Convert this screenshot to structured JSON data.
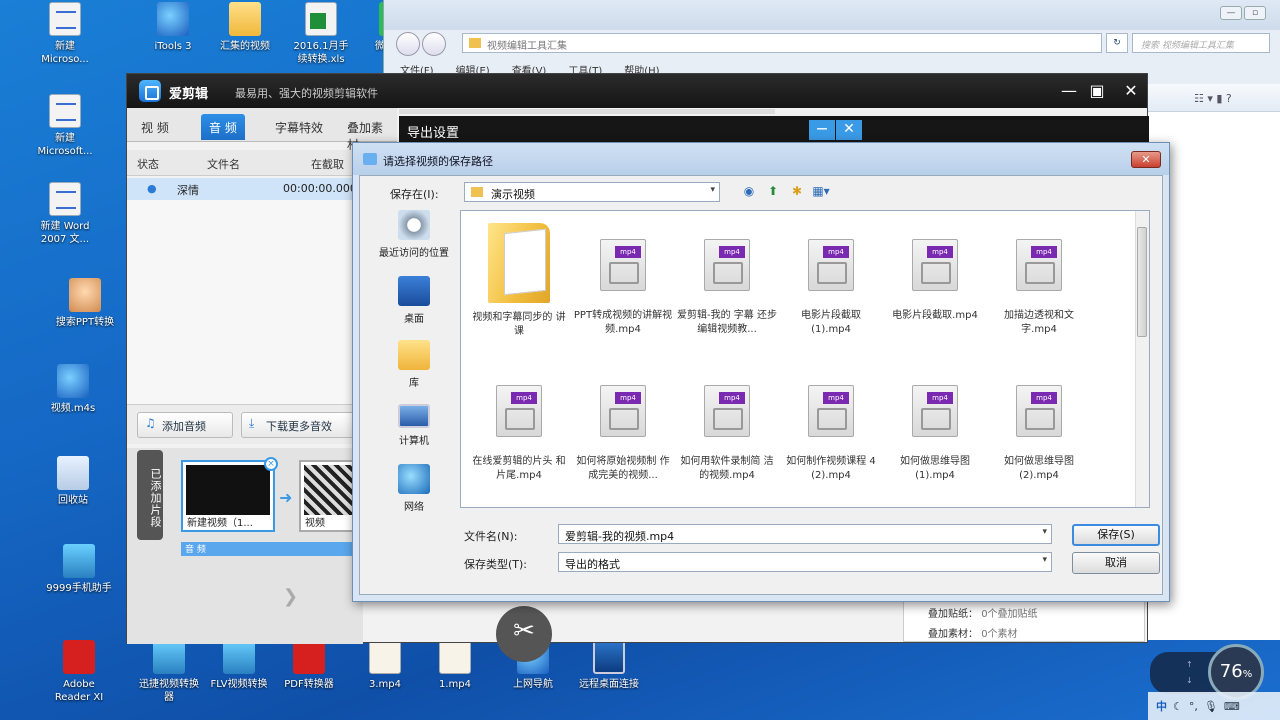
{
  "desktop": {
    "icons": [
      {
        "label": "新建 Microso...",
        "kind": "g-doc"
      },
      {
        "label": "iTools 3",
        "kind": "g-ie"
      },
      {
        "label": "汇集的视频",
        "kind": "g-folder"
      },
      {
        "label": "2016.1月手 续转换.xls",
        "kind": "g-xls"
      },
      {
        "label": "微信通讯",
        "kind": "g-green"
      },
      {
        "label": "新建 Microsoft...",
        "kind": "g-doc"
      },
      {
        "label": "新建 Word 2007 文...",
        "kind": "g-doc"
      },
      {
        "label": "搜索PPT转换",
        "kind": "g-face"
      },
      {
        "label": "视频.m4s",
        "kind": "g-ie"
      },
      {
        "label": "回收站",
        "kind": "g-bin"
      },
      {
        "label": "9999手机助手",
        "kind": "g-app"
      },
      {
        "label": "Adobe Reader XI",
        "kind": "g-red"
      },
      {
        "label": "迅捷视频转换器",
        "kind": "g-app"
      },
      {
        "label": "FLV视频转换",
        "kind": "g-app"
      },
      {
        "label": "PDF转换器",
        "kind": "g-red"
      },
      {
        "label": "3.mp4",
        "kind": "g-paper"
      },
      {
        "label": "1.mp4",
        "kind": "g-paper"
      },
      {
        "label": "上网导航",
        "kind": "g-ie"
      },
      {
        "label": "远程桌面连接",
        "kind": "g-screen"
      }
    ]
  },
  "explorer": {
    "address": "视频编辑工具汇集",
    "search_placeholder": "搜索 视频编辑工具汇集",
    "menu": [
      "文件(F)",
      "编辑(E)",
      "查看(V)",
      "工具(T)",
      "帮助(H)"
    ]
  },
  "editor": {
    "app_name": "爱剪辑",
    "slogan": "最易用、强大的视频剪辑软件",
    "tabs": [
      "视 频",
      "音 频",
      "字幕特效",
      "叠加素材"
    ],
    "table_headers": [
      "状态",
      "文件名",
      "在截取"
    ],
    "row": {
      "name": "深情",
      "time": "00:00:00.000"
    },
    "add_audio_label": "添加音频",
    "download_label": "下载更多音效",
    "side_tab": "已添加片段",
    "clip1_caption": "新建视频（1...",
    "clip2_caption": "视频",
    "audio_strip": "音 频",
    "export_title": "导出设置",
    "info_labels": [
      "叠加贴纸：",
      "叠加素材："
    ],
    "info_values": [
      "0个叠加贴纸",
      "0个素材"
    ]
  },
  "save_dialog": {
    "title": "请选择视频的保存路径",
    "save_in_label": "保存在(I):",
    "save_in_value": "演示视频",
    "places": [
      "最近访问的位置",
      "桌面",
      "库",
      "计算机",
      "网络"
    ],
    "files": [
      {
        "name": "视频和字幕同步的 讲课",
        "folder": true
      },
      {
        "name": "PPT转成视频的讲解视频.mp4"
      },
      {
        "name": "爱剪辑-我的 字幕 还步编辑视频教...",
        "folder": false
      },
      {
        "name": "电影片段截取 (1).mp4"
      },
      {
        "name": "电影片段截取.mp4"
      },
      {
        "name": "加描边透视和文字.mp4"
      },
      {
        "name": "在线爱剪辑的片头 和片尾.mp4"
      },
      {
        "name": "如何将原始视频制 作成完美的视频..."
      },
      {
        "name": "如何用软件录制简 洁的视频.mp4"
      },
      {
        "name": "如何制作视频课程 4 (2).mp4"
      },
      {
        "name": "如何做思维导图 (1).mp4"
      },
      {
        "name": "如何做思维导图 (2).mp4"
      }
    ],
    "filename_label": "文件名(N):",
    "filename_value": "爱剪辑-我的视频.mp4",
    "filetype_label": "保存类型(T):",
    "filetype_value": "导出的格式",
    "save_button": "保存(S)",
    "cancel_button": "取消"
  },
  "tray": {
    "percent": "76",
    "percent_suffix": "%",
    "ime": "中"
  }
}
